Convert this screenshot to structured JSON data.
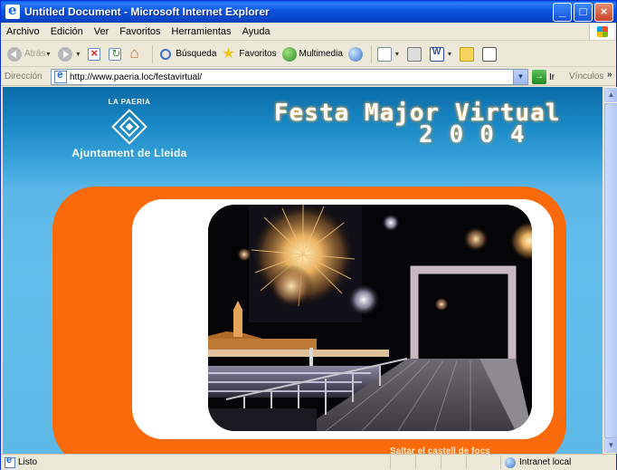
{
  "window": {
    "title": "Untitled Document - Microsoft Internet Explorer"
  },
  "menu": [
    "Archivo",
    "Edición",
    "Ver",
    "Favoritos",
    "Herramientas",
    "Ayuda"
  ],
  "toolbar": {
    "back_label": "Atrás",
    "search_label": "Búsqueda",
    "favorites_label": "Favoritos",
    "media_label": "Multimedia"
  },
  "address": {
    "label": "Dirección",
    "url": "http://www.paeria.loc/festavirtual/",
    "go_label": "Ir",
    "links_label": "Vínculos"
  },
  "page": {
    "logo_top": "LA PAERIA",
    "logo_name": "Ajuntament de Lleida",
    "title": "Festa Major Virtual",
    "year": "2004",
    "skip_link": "Saltar el castell de focs"
  },
  "status": {
    "text": "Listo",
    "zone": "Intranet local"
  },
  "colors": {
    "titlebar": "#0A5FEA",
    "page_bg": "#5EB9E8",
    "orange": "#FB6A0A"
  }
}
